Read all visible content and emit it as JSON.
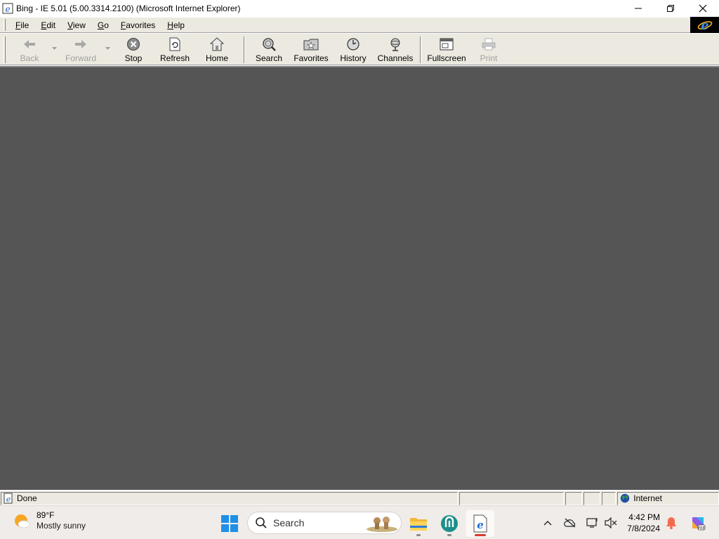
{
  "window": {
    "title": "Bing - IE 5.01 (5.00.3314.2100) (Microsoft Internet Explorer)"
  },
  "menu": {
    "items": [
      {
        "label_u": "F",
        "label_rest": "ile"
      },
      {
        "label_u": "E",
        "label_rest": "dit"
      },
      {
        "label_u": "V",
        "label_rest": "iew"
      },
      {
        "label_u": "G",
        "label_rest": "o"
      },
      {
        "label_u": "F",
        "label_rest": "avorites",
        "full": "Favorites"
      },
      {
        "label_u": "H",
        "label_rest": "elp"
      }
    ]
  },
  "toolbar": {
    "back": "Back",
    "forward": "Forward",
    "stop": "Stop",
    "refresh": "Refresh",
    "home": "Home",
    "search": "Search",
    "favorites": "Favorites",
    "history": "History",
    "channels": "Channels",
    "fullscreen": "Fullscreen",
    "print": "Print"
  },
  "statusbar": {
    "status": "Done",
    "zone": "Internet"
  },
  "taskbar": {
    "weather_temp": "89°F",
    "weather_cond": "Mostly sunny",
    "search_label": "Search",
    "time": "4:42 PM",
    "date": "7/8/2024"
  },
  "colors": {
    "content_bg": "#555555",
    "chrome_bg": "#ece9e0",
    "taskbar_bg": "#f0ece9"
  }
}
